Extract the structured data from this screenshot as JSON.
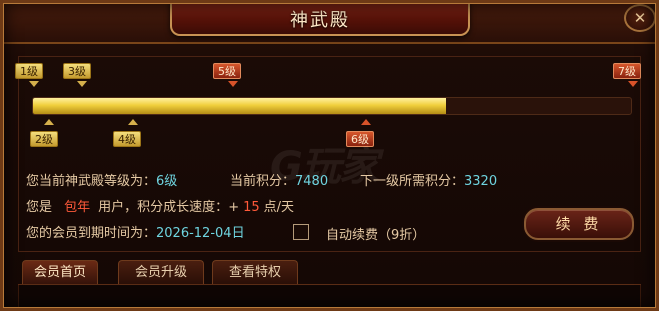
{
  "window": {
    "title": "神武殿",
    "close_icon": "close-icon"
  },
  "levels_top": [
    {
      "label": "1级",
      "style": "gold"
    },
    {
      "label": "3级",
      "style": "gold"
    },
    {
      "label": "5级",
      "style": "red"
    },
    {
      "label": "7级",
      "style": "red"
    }
  ],
  "levels_bottom": [
    {
      "label": "2级",
      "style": "gold"
    },
    {
      "label": "4级",
      "style": "gold"
    },
    {
      "label": "6级",
      "style": "red"
    }
  ],
  "progress": {
    "fraction": 0.69
  },
  "watermark": "G玩家",
  "info": {
    "current_level_label": "您当前神武殿等级为：",
    "current_level_value": "6级",
    "current_points_label": "当前积分：",
    "current_points_value": "7480",
    "next_points_label": "下一级所需积分：",
    "next_points_value": "3320",
    "user_prefix": "您是",
    "user_type": "包年",
    "user_suffix": "用户，积分成长速度：",
    "growth_plus": "+",
    "growth_value": "15",
    "growth_unit": "点/天",
    "expiry_label": "您的会员到期时间为：",
    "expiry_value": "2026-12-04日",
    "auto_renew_label": "自动续费（9折）"
  },
  "renew_button": "续 费",
  "tabs": [
    {
      "label": "会员首页",
      "active": true
    },
    {
      "label": "会员升级",
      "active": false
    },
    {
      "label": "查看特权",
      "active": false
    }
  ],
  "colors": {
    "accent_gold": "#f0cf3c",
    "value_cyan": "#6fd4e0",
    "highlight_red": "#ff5a3a"
  }
}
